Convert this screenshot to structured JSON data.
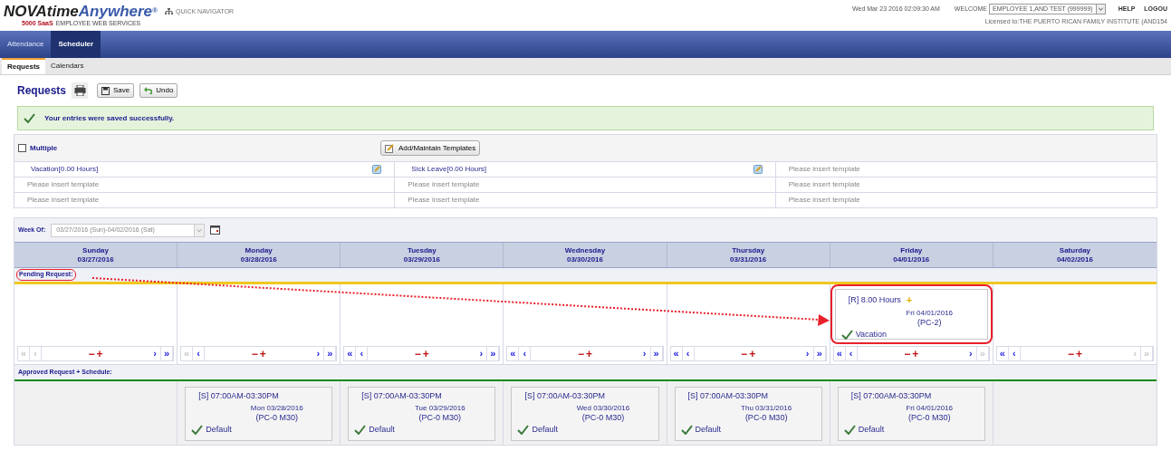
{
  "header": {
    "logo": {
      "brand_dark": "NOVAtime",
      "brand_blue": "Anywhere",
      "registered": "®",
      "edition": "5000 SaaS",
      "tagline": "EMPLOYEE WEB SERVICES"
    },
    "quick_navigator": "QUICK NAVIGATOR",
    "datetime": "Wed Mar 23 2016 02:09:30 AM",
    "welcome": "WELCOME",
    "user_select": "EMPLOYEE 1,AND TEST (999999)",
    "help": "HELP",
    "logout": "LOGOU",
    "licensed": "Licensed to:THE PUERTO RICAN FAMILY INSTITUTE (AND154"
  },
  "nav": [
    {
      "label": "Attendance",
      "selected": false
    },
    {
      "label": "Scheduler",
      "selected": true
    }
  ],
  "subtabs": [
    {
      "label": "Requests",
      "selected": true
    },
    {
      "label": "Calendars",
      "selected": false
    }
  ],
  "toolbar": {
    "title": "Requests",
    "save": "Save",
    "undo": "Undo"
  },
  "message": "Your entries were saved successfully.",
  "templates": {
    "multiple": {
      "label": "Multiple",
      "checked": false
    },
    "maintain_button": "Add/Maintain Templates",
    "rows": [
      [
        {
          "kind": "template",
          "label": "Vacation[0.00 Hours]"
        },
        {
          "kind": "template",
          "label": "Sick Leave[0.00 Hours]"
        },
        {
          "kind": "empty",
          "label": "Please insert template"
        }
      ],
      [
        {
          "kind": "empty",
          "label": "Please insert template"
        },
        {
          "kind": "empty",
          "label": "Please insert template"
        },
        {
          "kind": "empty",
          "label": "Please insert template"
        }
      ],
      [
        {
          "kind": "empty",
          "label": "Please insert template"
        },
        {
          "kind": "empty",
          "label": "Please insert template"
        },
        {
          "kind": "empty",
          "label": "Please insert template"
        }
      ]
    ]
  },
  "week": {
    "label": "Week Of:",
    "value": "03/27/2016 (Sun)-04/02/2016 (Sat)"
  },
  "pager_minus": "−",
  "pager_plus": "+",
  "pending": {
    "label": "Pending Request:",
    "highlighted": true,
    "arrow": true
  },
  "approved": {
    "label": "Approved Request + Schedule:"
  },
  "days": [
    {
      "name": "Sunday",
      "date": "03/27/2016",
      "pager": [
        {
          "label": "«",
          "disabled": true
        },
        {
          "label": "‹",
          "disabled": true
        },
        {
          "label": "›",
          "disabled": false
        },
        {
          "label": "»",
          "disabled": false
        }
      ]
    },
    {
      "name": "Monday",
      "date": "03/28/2016",
      "pager": [
        {
          "label": "«",
          "disabled": true
        },
        {
          "label": "‹",
          "disabled": false
        },
        {
          "label": "›",
          "disabled": false
        },
        {
          "label": "»",
          "disabled": false
        }
      ],
      "schedule": [
        {
          "title": "[S] 07:00AM-03:30PM",
          "date": "Mon 03/28/2016",
          "code": "(PC-0 M30)",
          "type": "Default"
        }
      ]
    },
    {
      "name": "Tuesday",
      "date": "03/29/2016",
      "pager": [
        {
          "label": "«",
          "disabled": false
        },
        {
          "label": "‹",
          "disabled": false
        },
        {
          "label": "›",
          "disabled": false
        },
        {
          "label": "»",
          "disabled": false
        }
      ],
      "schedule": [
        {
          "title": "[S] 07:00AM-03:30PM",
          "date": "Tue 03/29/2016",
          "code": "(PC-0 M30)",
          "type": "Default"
        }
      ]
    },
    {
      "name": "Wednesday",
      "date": "03/30/2016",
      "pager": [
        {
          "label": "«",
          "disabled": false
        },
        {
          "label": "‹",
          "disabled": false
        },
        {
          "label": "›",
          "disabled": false
        },
        {
          "label": "»",
          "disabled": false
        }
      ],
      "schedule": [
        {
          "title": "[S] 07:00AM-03:30PM",
          "date": "Wed 03/30/2016",
          "code": "(PC-0 M30)",
          "type": "Default"
        }
      ]
    },
    {
      "name": "Thursday",
      "date": "03/31/2016",
      "pager": [
        {
          "label": "«",
          "disabled": false
        },
        {
          "label": "‹",
          "disabled": false
        },
        {
          "label": "›",
          "disabled": false
        },
        {
          "label": "»",
          "disabled": false
        }
      ],
      "schedule": [
        {
          "title": "[S] 07:00AM-03:30PM",
          "date": "Thu 03/31/2016",
          "code": "(PC-0 M30)",
          "type": "Default"
        }
      ]
    },
    {
      "name": "Friday",
      "date": "04/01/2016",
      "pager": [
        {
          "label": "«",
          "disabled": false
        },
        {
          "label": "‹",
          "disabled": false
        },
        {
          "label": "›",
          "disabled": false
        },
        {
          "label": "»",
          "disabled": true
        }
      ],
      "pending": [
        {
          "title": "[R] 8.00 Hours",
          "plus": "+",
          "date": "Fri 04/01/2016",
          "code": "(PC-2)",
          "type": "Vacation",
          "highlighted": true
        }
      ],
      "schedule": [
        {
          "title": "[S] 07:00AM-03:30PM",
          "date": "Fri 04/01/2016",
          "code": "(PC-0 M30)",
          "type": "Default"
        }
      ]
    },
    {
      "name": "Saturday",
      "date": "04/02/2016",
      "pager": [
        {
          "label": "«",
          "disabled": false
        },
        {
          "label": "‹",
          "disabled": false
        },
        {
          "label": "›",
          "disabled": true
        },
        {
          "label": "»",
          "disabled": true
        }
      ]
    }
  ]
}
